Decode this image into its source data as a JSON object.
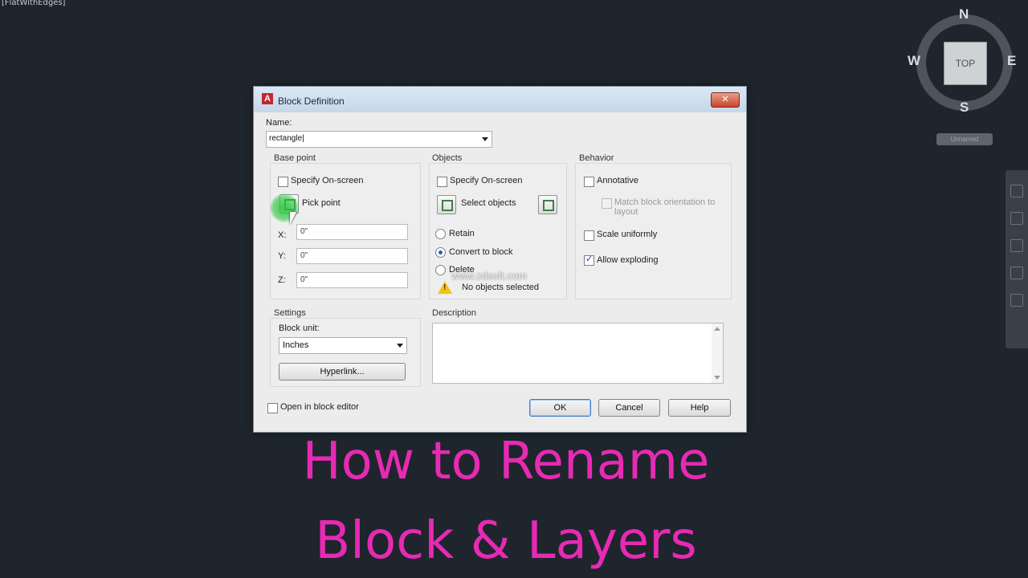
{
  "viewport_label": "[FlatWithEdges]",
  "viewcube": {
    "top": "TOP",
    "north": "N",
    "south": "S",
    "east": "E",
    "west": "W",
    "wcs_label": "Unnamed"
  },
  "dialog": {
    "title": "Block Definition",
    "close_glyph": "✕",
    "name_label": "Name:",
    "name_value": "rectangle|",
    "base_point": {
      "title": "Base point",
      "specify_on_screen": "Specify On-screen",
      "pick_point": "Pick point",
      "x_label": "X:",
      "x_value": "0\"",
      "y_label": "Y:",
      "y_value": "0\"",
      "z_label": "Z:",
      "z_value": "0\""
    },
    "objects": {
      "title": "Objects",
      "specify_on_screen": "Specify On-screen",
      "select_objects": "Select objects",
      "retain": "Retain",
      "convert_to_block": "Convert to block",
      "delete": "Delete",
      "status": "No objects selected"
    },
    "behavior": {
      "title": "Behavior",
      "annotative": "Annotative",
      "match_orientation": "Match block orientation to layout",
      "scale_uniformly": "Scale uniformly",
      "allow_exploding": "Allow exploding"
    },
    "settings": {
      "title": "Settings",
      "block_unit_label": "Block unit:",
      "block_unit_value": "Inches",
      "hyperlink": "Hyperlink..."
    },
    "description": {
      "title": "Description",
      "value": ""
    },
    "open_in_block_editor": "Open in block editor",
    "ok": "OK",
    "cancel": "Cancel",
    "help": "Help"
  },
  "watermark": "www.zdsoft.com",
  "caption": {
    "line1": "How to Rename",
    "line2": "Block & Layers"
  },
  "colors": {
    "background": "#1f252c",
    "caption": "#e72ab4",
    "dialog": "#ececec"
  }
}
